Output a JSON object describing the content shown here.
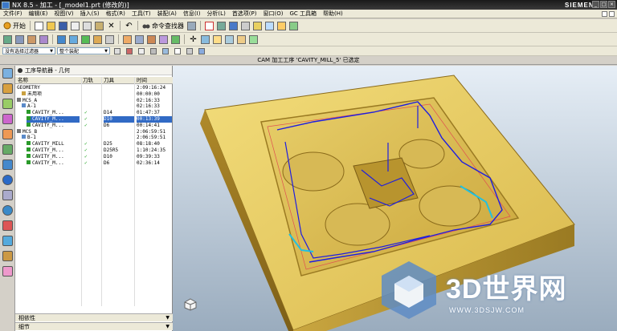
{
  "window": {
    "title": "NX 8.5 - 加工 - [_model1.prt (修改的)]",
    "brand": "SIEMENS",
    "buttons": [
      "_",
      "□",
      "×"
    ]
  },
  "menu": [
    "文件(F)",
    "编辑(E)",
    "视图(V)",
    "插入(S)",
    "格式(R)",
    "工具(T)",
    "装配(A)",
    "信息(I)",
    "分析(L)",
    "首选项(P)",
    "窗口(O)",
    "GC 工具箱",
    "帮助(H)"
  ],
  "toolbar": {
    "start_label": "开始",
    "command_finder": "命令查找器"
  },
  "filter": {
    "selection_filter": "没有选择过滤器",
    "assembly_scope": "整个装配"
  },
  "status": {
    "message": "CAM 加工工序 'CAVITY_MILL_5' 已选定"
  },
  "navigator": {
    "title": "工序导航器 - 几何",
    "columns": {
      "name": "名称",
      "path": "刀轨",
      "tool": "刀具",
      "time": "时间"
    },
    "rows": [
      {
        "name": "GEOMETRY",
        "check": "",
        "tool": "",
        "time": "2:09:16:24"
      },
      {
        "name": "未用项",
        "check": "",
        "tool": "",
        "time": "00:00:00"
      },
      {
        "name": "MCS_A",
        "check": "",
        "tool": "",
        "time": "02:16:33"
      },
      {
        "name": "A-1",
        "check": "",
        "tool": "",
        "time": "02:16:33"
      },
      {
        "name": "CAVITY_M...",
        "check": "✓",
        "tool": "D14",
        "time": "01:47:37"
      },
      {
        "name": "CAVITY_M...",
        "check": "✓",
        "tool": "D10",
        "time": "00:13:39"
      },
      {
        "name": "CAVITY_M...",
        "check": "✓",
        "tool": "D6",
        "time": "00:14:41"
      },
      {
        "name": "MCS_B",
        "check": "",
        "tool": "",
        "time": "2:06:59:51"
      },
      {
        "name": "B-1",
        "check": "",
        "tool": "",
        "time": "2:06:59:51"
      },
      {
        "name": "CAVITY_MILL",
        "check": "✓",
        "tool": "D25",
        "time": "08:18:40"
      },
      {
        "name": "CAVITY_M...",
        "check": "✓",
        "tool": "D25R5",
        "time": "1:10:24:35"
      },
      {
        "name": "CAVITY_M...",
        "check": "✓",
        "tool": "D10",
        "time": "09:39:33"
      },
      {
        "name": "CAVITY_M...",
        "check": "✓",
        "tool": "D6",
        "time": "02:36:14"
      }
    ],
    "footer": {
      "dependencies": "相依性",
      "details": "细节"
    }
  },
  "watermark": {
    "main": "3D世界网",
    "url": "WWW.3DSJW.COM"
  },
  "colors": {
    "titlebar": "#2a2a2a",
    "selection": "#316ac5",
    "check": "#0a9a0a",
    "part": "#d9b84c",
    "toolpath": "#1e1ee0"
  }
}
